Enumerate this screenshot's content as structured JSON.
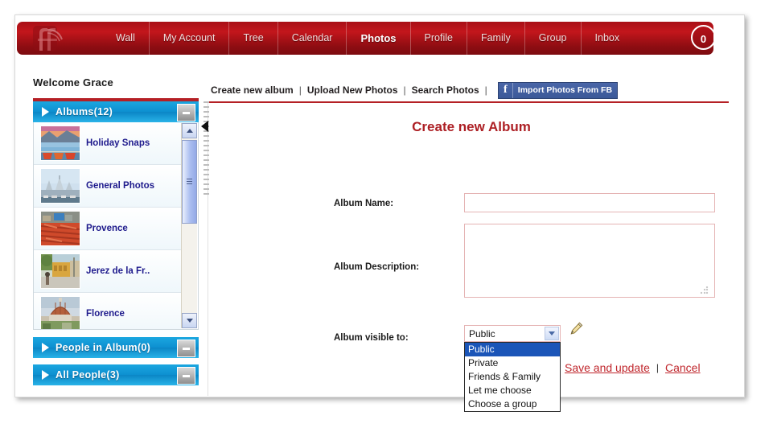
{
  "nav": {
    "logo_alt": "ff-logo",
    "items": [
      {
        "label": "Wall",
        "active": false
      },
      {
        "label": "My Account",
        "active": false
      },
      {
        "label": "Tree",
        "active": false
      },
      {
        "label": "Calendar",
        "active": false
      },
      {
        "label": "Photos",
        "active": true
      },
      {
        "label": "Profile",
        "active": false
      },
      {
        "label": "Family",
        "active": false
      },
      {
        "label": "Group",
        "active": false
      },
      {
        "label": "Inbox",
        "active": false
      }
    ],
    "badge_count": "0"
  },
  "welcome": "Welcome Grace",
  "subnav": {
    "create_album": "Create new album",
    "upload_photos": "Upload New Photos",
    "search_photos": "Search Photos",
    "separator": "|",
    "fb_icon_letter": "f",
    "fb_import": "Import Photos From FB"
  },
  "sidebar": {
    "albums_panel": {
      "title": "Albums(12)",
      "collapse_label": "-",
      "albums": [
        {
          "name": "Holiday Snaps",
          "thumb": "lake-boats-sunset"
        },
        {
          "name": "General Photos",
          "thumb": "harbour-city"
        },
        {
          "name": "Provence",
          "thumb": "red-market-stall"
        },
        {
          "name": "Jerez de la Fr..",
          "thumb": "yellow-building-street"
        },
        {
          "name": "Florence",
          "thumb": "duomo-dome"
        }
      ]
    },
    "people_in_album_panel": {
      "title": "People in Album(0)",
      "collapse_label": "-"
    },
    "all_people_panel": {
      "title": "All People(3)",
      "collapse_label": "-"
    }
  },
  "main": {
    "title": "Create new Album",
    "album_name": {
      "label": "Album Name:",
      "value": "",
      "placeholder": ""
    },
    "album_description": {
      "label": "Album Description:",
      "value": "",
      "placeholder": ""
    },
    "album_visible": {
      "label": "Album visible to:",
      "selected": "Public",
      "options": [
        "Public",
        "Private",
        "Friends & Family",
        "Let me choose",
        "Choose a group"
      ]
    },
    "edit_icon": "pencil-icon",
    "save_link": "Save and update",
    "action_separator": "|",
    "cancel_link": "Cancel"
  },
  "colors": {
    "brand_red": "#b52025",
    "nav_red": "#c3161c",
    "panel_blue": "#0d8fd0",
    "link_red": "#c0272d",
    "album_name_blue": "#1e1a8c",
    "fb_blue": "#3b5998",
    "select_highlight": "#1b55b8"
  }
}
